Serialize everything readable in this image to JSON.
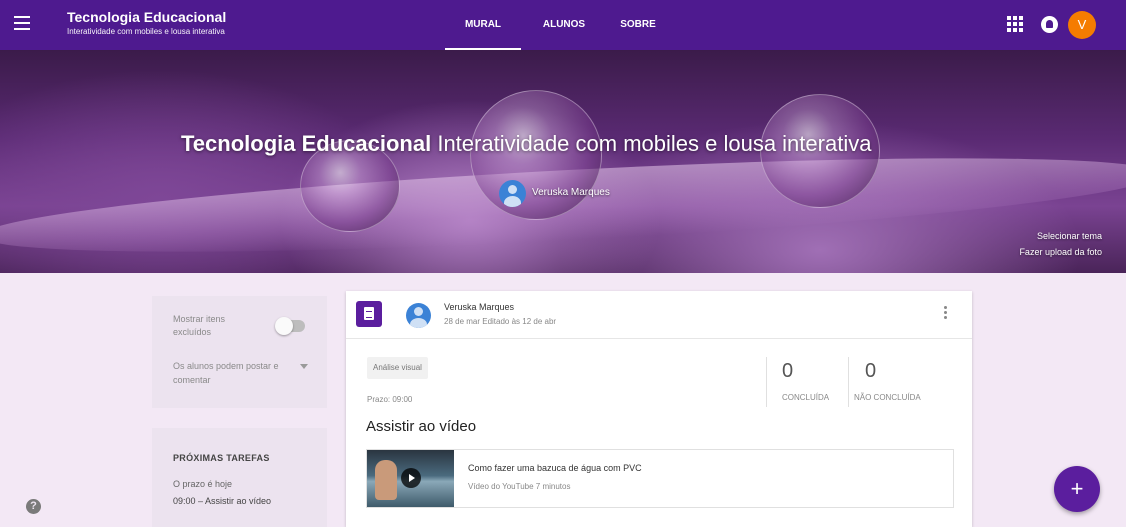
{
  "header": {
    "title": "Tecnologia Educacional",
    "subtitle": "Interatividade com mobiles e lousa interativa",
    "tabs": [
      {
        "label": "MURAL",
        "active": true
      },
      {
        "label": "ALUNOS",
        "active": false
      },
      {
        "label": "SOBRE",
        "active": false
      }
    ],
    "avatar_initial": "V",
    "colors": {
      "bar": "#4e1a8f",
      "avatar": "#f57c00"
    },
    "icons": [
      "menu-icon",
      "apps-icon",
      "notifications-icon"
    ]
  },
  "banner": {
    "class_name": "Tecnologia Educacional",
    "section": "Interatividade com mobiles e lousa interativa",
    "teacher": "Veruska Marques",
    "select_theme": "Selecionar tema",
    "upload_photo": "Fazer upload da foto"
  },
  "sidebar": {
    "show_deleted_label": "Mostrar itens excluídos",
    "show_deleted_enabled": false,
    "post_permission": "Os alunos podem postar e comentar",
    "upcoming": {
      "title": "PRÓXIMAS TAREFAS",
      "due": "O prazo é hoje",
      "task": "09:00 – Assistir ao vídeo"
    }
  },
  "post": {
    "author": "Veruska Marques",
    "date": "28 de mar Editado às 12 de abr",
    "topic": "Análise visual",
    "due": "Prazo: 09:00",
    "title": "Assistir ao vídeo",
    "done_count": "0",
    "done_label": "CONCLUÍDA",
    "not_done_count": "0",
    "not_done_label": "NÃO CONCLUÍDA",
    "attachment": {
      "title": "Como fazer uma bazuca de água com PVC",
      "meta": "Vídeo do YouTube  7 minutos"
    }
  },
  "fab_label": "+",
  "help_label": "?"
}
